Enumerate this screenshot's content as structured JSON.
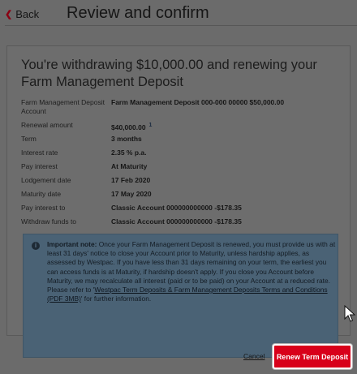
{
  "header": {
    "back_label": "Back",
    "title": "Review and confirm"
  },
  "summary": {
    "title": "You're withdrawing $10,000.00 and renewing your Farm Management Deposit",
    "rows": [
      {
        "label": "Farm Management Deposit Account",
        "value": "Farm Management Deposit 000-000 00000  $50,000.00"
      },
      {
        "label": "Renewal amount",
        "value": "$40,000.00",
        "badge": "1"
      },
      {
        "label": "Term",
        "value": "3 months"
      },
      {
        "label": "Interest rate",
        "value": "2.35 % p.a."
      },
      {
        "label": "Pay interest",
        "value": "At Maturity"
      },
      {
        "label": "Lodgement date",
        "value": "17 Feb 2020"
      },
      {
        "label": "Maturity date",
        "value": "17 May 2020"
      },
      {
        "label": "Pay interest to",
        "value": "Classic Account 000000000000  -$178.35"
      },
      {
        "label": "Withdraw funds to",
        "value": "Classic Account 000000000000  -$178.35"
      }
    ]
  },
  "note": {
    "icon": "info-icon",
    "heading": "Important note:",
    "body": " Once your Farm Management Deposit is renewed, you must provide us with at least 31 days' notice to close your Account prior to Maturity, unless hardship applies, as assessed by Westpac. If you have less than 31 days remaining on your term, the earliest you can access funds is at Maturity, if hardship doesn't apply. If you close you Account before Maturity, we may recalculate all interest (paid or to be paid) on your Account at a reduced rate. Please refer to '",
    "link": "Westpac Term Deposits & Farm Management Deposits Terms and Conditions (PDF 3MB)",
    "tail": "' for further information."
  },
  "actions": {
    "cancel_label": "Cancel",
    "confirm_label": "Renew Term Deposit"
  },
  "colors": {
    "brand_red": "#d8001a",
    "note_bg": "#4a6275",
    "overlay_bg": "#6b6b6b"
  }
}
